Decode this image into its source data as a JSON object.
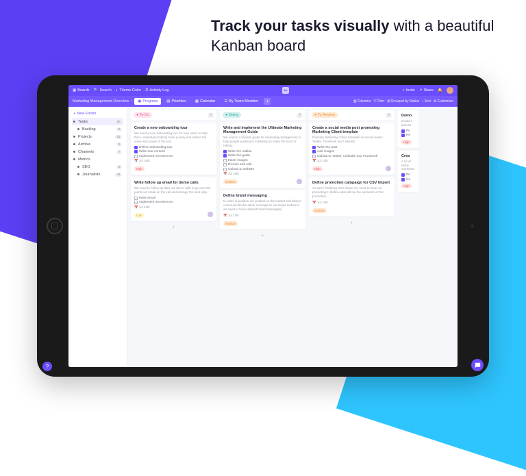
{
  "hero": {
    "bold": "Track your tasks visually",
    "rest": " with a beautiful Kanban board"
  },
  "topbar": {
    "left": [
      "Boards",
      "Search",
      "Theme Color",
      "Activity Log"
    ],
    "right": [
      "Invite",
      "Share"
    ]
  },
  "breadcrumb": "Marketing Management Overview",
  "tabs": [
    "Progress",
    "Priorities",
    "Calendar",
    "By Team Member"
  ],
  "active_tab": 0,
  "toolbar": [
    "Columns",
    "Filter",
    "Grouped by Status",
    "Sort",
    "Customize"
  ],
  "sidebar": {
    "new_folder": "New Folder",
    "items": [
      {
        "label": "Tasks",
        "count": "16",
        "active": true,
        "child": false
      },
      {
        "label": "Backlog",
        "count": "9",
        "child": true
      },
      {
        "label": "Projects",
        "count": "12",
        "child": false
      },
      {
        "label": "Archive",
        "count": "3",
        "child": false
      },
      {
        "label": "Channels",
        "count": "7",
        "child": false
      },
      {
        "label": "Metrics",
        "count": "",
        "child": false
      },
      {
        "label": "SEO",
        "count": "5",
        "child": true
      },
      {
        "label": "Journalists",
        "count": "11",
        "child": true
      }
    ]
  },
  "columns": [
    {
      "title": "To Do",
      "count": "3",
      "status_class": "status-todo",
      "cards": [
        {
          "title": "Create a new onboarding tour",
          "desc": "We need a new onboarding tour for new users to help them understand Infinity more quickly and realize the value and power of the tool.",
          "checks": [
            {
              "t": "Define onboarding tour",
              "done": true
            },
            {
              "t": "Write tour content",
              "done": true
            },
            {
              "t": "Implement via Intercom",
              "done": false
            }
          ],
          "date": "Jul 16th",
          "tag": "High",
          "tag_class": "tag-high"
        },
        {
          "title": "Write follow up email for demo calls",
          "desc": "We need to follow up after our demo calls to go over the points we made on the call and arrange the next step.",
          "checks": [
            {
              "t": "Write email",
              "done": false
            },
            {
              "t": "Implement via Intercom",
              "done": false
            }
          ],
          "date": "Jul 24th",
          "tag": "Low",
          "tag_class": "tag-low",
          "avatar": true
        }
      ]
    },
    {
      "title": "Doing",
      "count": "2",
      "status_class": "status-doing",
      "cards": [
        {
          "title": "Write and implement the Ultimate Marketing Management Guide",
          "desc": "We need a complete guide for marketing management to help people working in marketing to make the most of Infinity.",
          "checks": [
            {
              "t": "Write the outline",
              "done": true
            },
            {
              "t": "Write the guide",
              "done": true
            },
            {
              "t": "Insert images",
              "done": false
            },
            {
              "t": "Review and edit",
              "done": false
            },
            {
              "t": "Upload to website",
              "done": false
            }
          ],
          "date": "Jul 19th",
          "tag": "Medium",
          "tag_class": "tag-medium",
          "avatar": true
        },
        {
          "title": "Define brand messaging",
          "desc": "In order to position our product on the market and always communicate the same message to our target audience we need to have defined brand messaging.",
          "checks": [],
          "date": "Jul 17th",
          "tag": "Medium",
          "tag_class": "tag-medium"
        }
      ]
    },
    {
      "title": "To Review",
      "count": "3",
      "status_class": "status-review",
      "cards": [
        {
          "title": "Create a social media post promoting Marketing Client template",
          "desc": "Promote Marketing Client template on social media: Twitter, Facebook and LinkedIn.",
          "checks": [
            {
              "t": "Write the post",
              "done": true
            },
            {
              "t": "Add images",
              "done": true
            },
            {
              "t": "Upload to Twitter, LinkedIn and Facebook",
              "done": false
            }
          ],
          "date": "Jul 13th",
          "tag": "High",
          "tag_class": "tag-high",
          "avatar": true
        },
        {
          "title": "Define promotion campaign for CSV Import",
          "desc": "As we're finalizing CSV import we need to focus on promoting it. Define what will be the elements of this promotion.",
          "checks": [],
          "date": "Jul 12th",
          "tag": "Medium",
          "tag_class": "tag-medium"
        }
      ]
    }
  ],
  "cut_column": {
    "cards": [
      {
        "title": "Demo",
        "desc": "product and Su"
      },
      {
        "title": "Crea",
        "desc": "A lot of niche marketed"
      }
    ]
  }
}
